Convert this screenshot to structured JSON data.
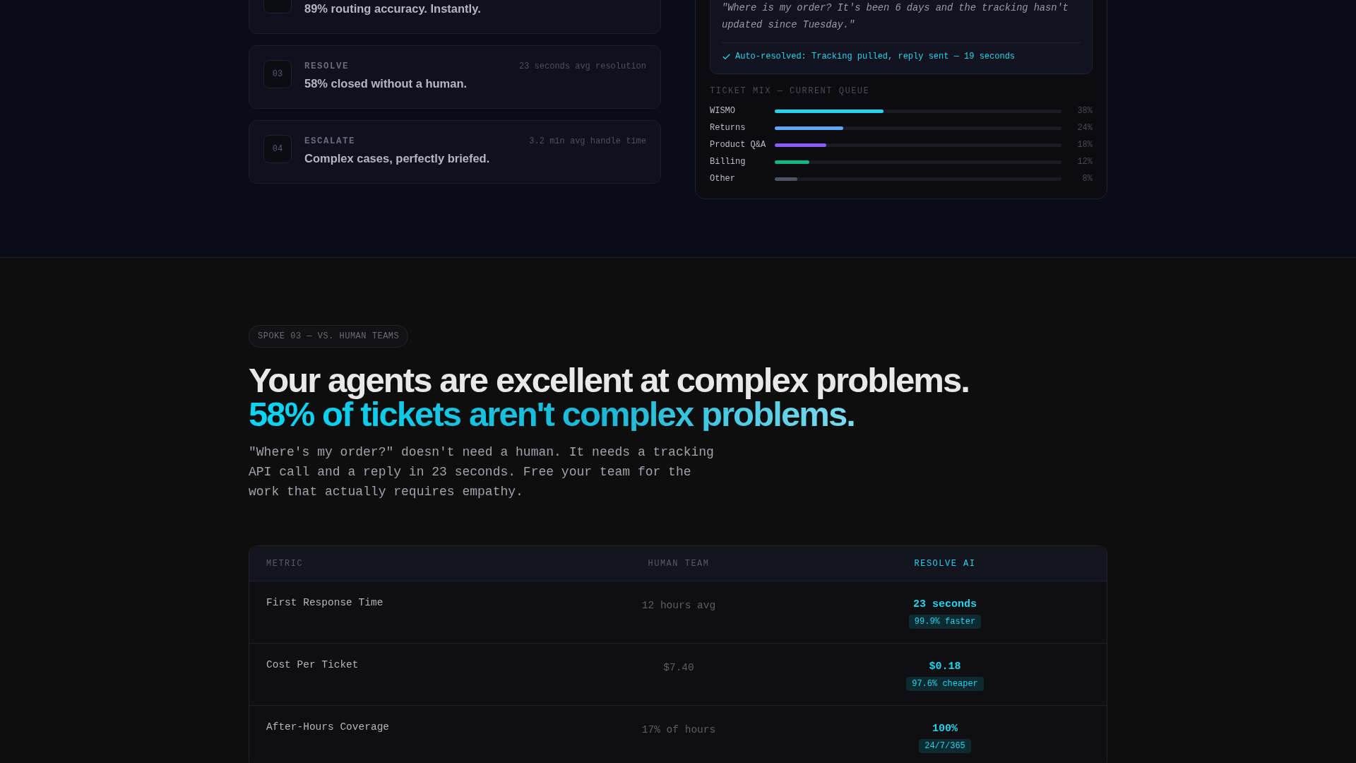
{
  "steps": [
    {
      "title": "89% routing accuracy. Instantly."
    },
    {
      "number": "03",
      "label": "RESOLVE",
      "meta": "23 seconds avg resolution",
      "title": "58% closed without a human."
    },
    {
      "number": "04",
      "label": "ESCALATE",
      "meta": "3.2 min avg handle time",
      "title": "Complex cases, perfectly briefed."
    }
  ],
  "ticket_panel": {
    "quote": "\"Where is my order? It's been 6 days and the tracking hasn't updated since Tuesday.\"",
    "resolution": "Auto-resolved: Tracking pulled, reply sent — 19 seconds",
    "mix_title": "TICKET MIX — CURRENT QUEUE",
    "mix": [
      {
        "name": "WISMO",
        "level": 0.38,
        "reading": "38%",
        "color": "#22d3ee"
      },
      {
        "name": "Returns",
        "level": 0.24,
        "reading": "24%",
        "color": "#60a5fa"
      },
      {
        "name": "Product Q&A",
        "level": 0.18,
        "reading": "18%",
        "color": "#8b5cf6"
      },
      {
        "name": "Billing",
        "level": 0.12,
        "reading": "12%",
        "color": "#10b981"
      },
      {
        "name": "Other",
        "level": 0.08,
        "reading": "8%",
        "color": "#4b5563"
      }
    ]
  },
  "comparison": {
    "badge": "SPOKE 03 — VS. HUMAN TEAMS",
    "headline": "Your agents are excellent at complex problems.",
    "headline_accent": "58% of tickets aren't complex problems.",
    "body": "\"Where's my order?\" doesn't need a human. It needs a tracking API call and a reply in 23 seconds. Free your team for the work that actually requires empathy.",
    "table": {
      "columns": [
        "METRIC",
        "HUMAN TEAM",
        "RESOLVE AI"
      ],
      "rows": [
        {
          "metric": "First Response Time",
          "human": "12 hours avg",
          "ai": "23 seconds",
          "delta": "99.9% faster"
        },
        {
          "metric": "Cost Per Ticket",
          "human": "$7.40",
          "ai": "$0.18",
          "delta": "97.6% cheaper"
        },
        {
          "metric": "After-Hours Coverage",
          "human": "17% of hours",
          "ai": "100%",
          "delta": "24/7/365"
        }
      ]
    }
  }
}
